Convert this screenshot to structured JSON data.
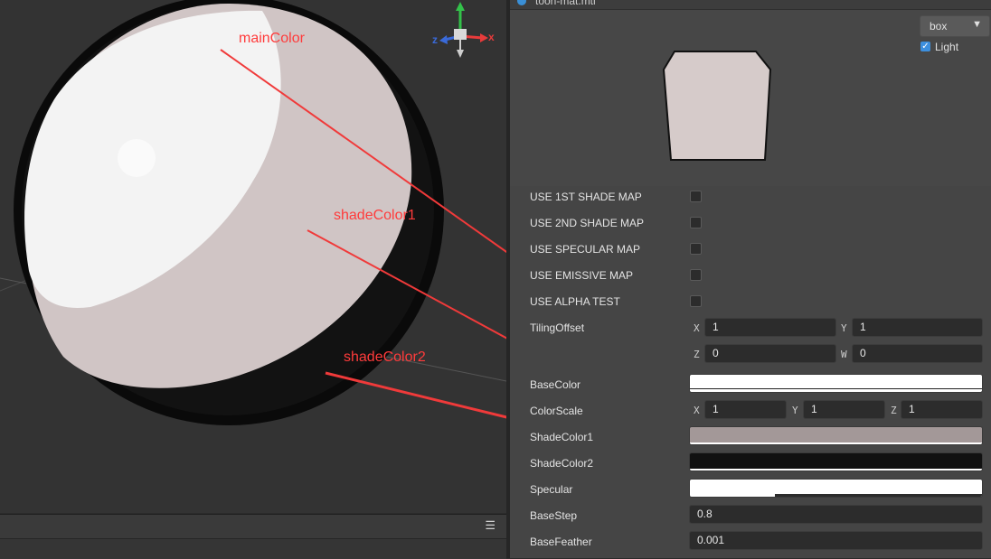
{
  "inspector": {
    "tab_title": "toon-mat.mtl",
    "preview": {
      "shape_select": "box",
      "light_label": "Light",
      "light_checked": true
    },
    "rows": {
      "use_1st_shade_map": "USE 1ST SHADE MAP",
      "use_2nd_shade_map": "USE 2ND SHADE MAP",
      "use_specular_map": "USE SPECULAR MAP",
      "use_emissive_map": "USE EMISSIVE MAP",
      "use_alpha_test": "USE ALPHA TEST",
      "tiling_offset": "TilingOffset",
      "base_color": "BaseColor",
      "color_scale": "ColorScale",
      "shade_color1": "ShadeColor1",
      "shade_color2": "ShadeColor2",
      "specular": "Specular",
      "base_step": "BaseStep",
      "base_feather": "BaseFeather"
    },
    "tiling": {
      "x_label": "X",
      "x": "1",
      "y_label": "Y",
      "y": "1",
      "z_label": "Z",
      "z": "0",
      "w_label": "W",
      "w": "0"
    },
    "color_scale": {
      "x_label": "X",
      "x": "1",
      "y_label": "Y",
      "y": "1",
      "z_label": "Z",
      "z": "1"
    },
    "base_step": "0.8",
    "base_feather": "0.001",
    "colors": {
      "base_color": "#ffffff",
      "shade_color1": "#a39898",
      "shade_color2": "#111111",
      "specular": "#ffffff",
      "preview_box": "#d6cbca"
    }
  },
  "scene": {
    "annotations": {
      "main": "mainColor",
      "shade1": "shadeColor1",
      "shade2": "shadeColor2"
    },
    "gizmo": {
      "x": "x",
      "y": "y",
      "z": "z"
    },
    "menu_icon": "hamburger-icon",
    "annotation_color": "#ff3b3b"
  }
}
